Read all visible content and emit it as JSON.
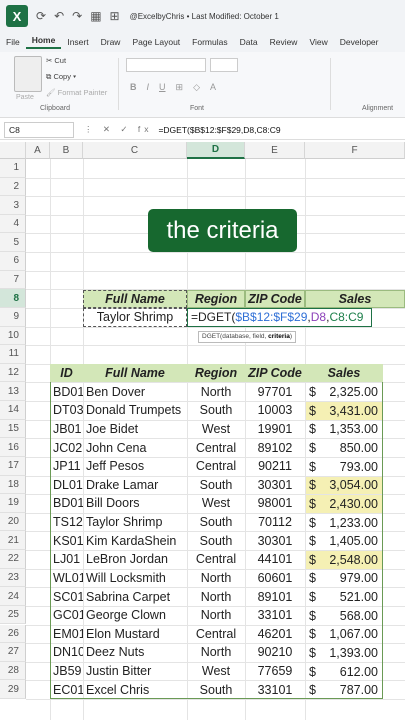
{
  "titlebar": {
    "logo": "X",
    "title": "@ExcelbyChris  •  Last Modified: October 1"
  },
  "menu": [
    "File",
    "Home",
    "Insert",
    "Draw",
    "Page Layout",
    "Formulas",
    "Data",
    "Review",
    "View",
    "Developer"
  ],
  "menu_active": "Home",
  "ribbon": {
    "paste": "Paste",
    "cut": "Cut",
    "copy": "Copy",
    "format_painter": "Format Painter",
    "clipboard": "Clipboard",
    "font": "Font",
    "alignment": "Alignment",
    "bold": "B",
    "italic": "I",
    "underline": "U"
  },
  "formula_bar": {
    "name_box": "C8",
    "icons": "⋮ ✕ ✓ fx",
    "formula": "=DGET($B$12:$F$29,D8,C8:C9"
  },
  "columns": [
    "A",
    "B",
    "C",
    "D",
    "E",
    "F"
  ],
  "rows": [
    1,
    2,
    3,
    4,
    5,
    6,
    7,
    8,
    9,
    10,
    11,
    12,
    13,
    14,
    15,
    16,
    17,
    18,
    19,
    20,
    21,
    22,
    23,
    24,
    25,
    26,
    27,
    28,
    29
  ],
  "banner": "the criteria",
  "criteria": {
    "headers": [
      "Full Name",
      "Region",
      "ZIP Code",
      "Sales"
    ],
    "name": "Taylor Shrimp",
    "formula_parts": [
      "=DGET(",
      "$B$12:$F$29",
      ",",
      "D8",
      ",",
      "C8:C9"
    ]
  },
  "tooltip": {
    "prefix": "DGET(database, field, ",
    "bold": "criteria",
    "suffix": ")"
  },
  "table": {
    "headers": [
      "ID",
      "Full Name",
      "Region",
      "ZIP Code",
      "Sales"
    ],
    "rows": [
      {
        "id": "BD01",
        "name": "Ben Dover",
        "region": "North",
        "zip": "97701",
        "sales": "2,325.00",
        "hl": false
      },
      {
        "id": "DT03",
        "name": "Donald Trumpets",
        "region": "South",
        "zip": "10003",
        "sales": "3,431.00",
        "hl": true
      },
      {
        "id": "JB01",
        "name": "Joe Bidet",
        "region": "West",
        "zip": "19901",
        "sales": "1,353.00",
        "hl": false
      },
      {
        "id": "JC02",
        "name": "John Cena",
        "region": "Central",
        "zip": "89102",
        "sales": "850.00",
        "hl": false
      },
      {
        "id": "JP11",
        "name": "Jeff Pesos",
        "region": "Central",
        "zip": "90211",
        "sales": "793.00",
        "hl": false
      },
      {
        "id": "DL01",
        "name": "Drake Lamar",
        "region": "South",
        "zip": "30301",
        "sales": "3,054.00",
        "hl": true
      },
      {
        "id": "BD01",
        "name": "Bill Doors",
        "region": "West",
        "zip": "98001",
        "sales": "2,430.00",
        "hl": true
      },
      {
        "id": "TS12",
        "name": "Taylor Shrimp",
        "region": "South",
        "zip": "70112",
        "sales": "1,233.00",
        "hl": false
      },
      {
        "id": "KS01",
        "name": "Kim KardaShein",
        "region": "South",
        "zip": "30301",
        "sales": "1,405.00",
        "hl": false
      },
      {
        "id": "LJ01",
        "name": "LeBron Jordan",
        "region": "Central",
        "zip": "44101",
        "sales": "2,548.00",
        "hl": true
      },
      {
        "id": "WL01",
        "name": "Will Locksmith",
        "region": "North",
        "zip": "60601",
        "sales": "979.00",
        "hl": false
      },
      {
        "id": "SC01",
        "name": "Sabrina Carpet",
        "region": "North",
        "zip": "89101",
        "sales": "521.00",
        "hl": false
      },
      {
        "id": "GC01",
        "name": "George Clown",
        "region": "North",
        "zip": "33101",
        "sales": "568.00",
        "hl": false
      },
      {
        "id": "EM01",
        "name": "Elon Mustard",
        "region": "Central",
        "zip": "46201",
        "sales": "1,067.00",
        "hl": false
      },
      {
        "id": "DN10",
        "name": "Deez Nuts",
        "region": "North",
        "zip": "90210",
        "sales": "1,393.00",
        "hl": false
      },
      {
        "id": "JB59",
        "name": "Justin Bitter",
        "region": "West",
        "zip": "77659",
        "sales": "612.00",
        "hl": false
      },
      {
        "id": "EC01",
        "name": "Excel Chris",
        "region": "South",
        "zip": "33101",
        "sales": "787.00",
        "hl": false
      }
    ]
  },
  "colors": {
    "accent": "#1e7145",
    "banner": "#17682f",
    "header_fill": "#d3e7b8",
    "highlight": "#f5f0b4"
  }
}
